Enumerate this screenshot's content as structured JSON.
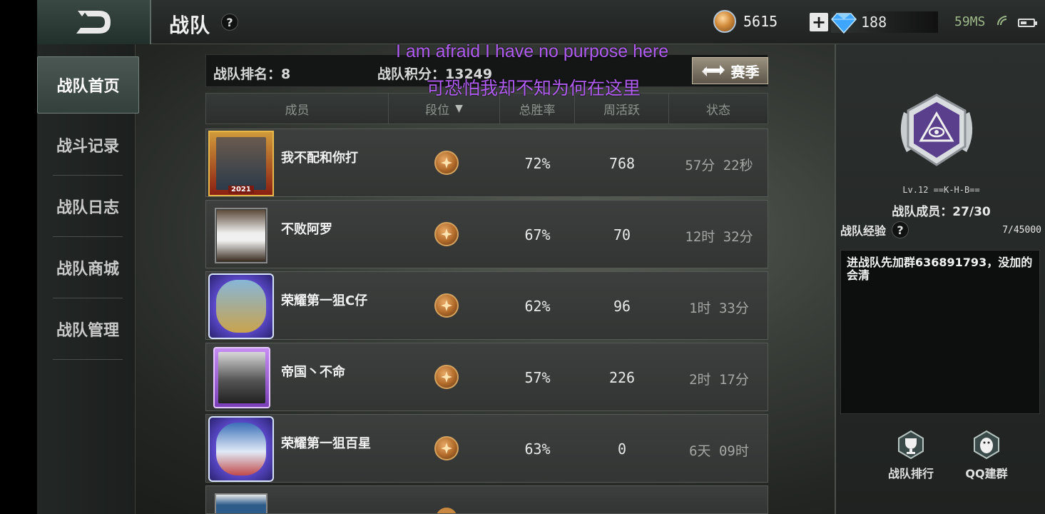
{
  "header": {
    "title": "战队",
    "help": "?",
    "coins": "5615",
    "gems": "188",
    "ping": "59MS"
  },
  "sidebar": {
    "items": [
      {
        "label": "战队首页"
      },
      {
        "label": "战斗记录"
      },
      {
        "label": "战队日志"
      },
      {
        "label": "战队商城"
      },
      {
        "label": "战队管理"
      }
    ]
  },
  "team": {
    "rank_label": "战队排名：8",
    "score_label": "战队积分：13249",
    "season_button": "赛季"
  },
  "table": {
    "headers": [
      "成员",
      "段位",
      "总胜率",
      "周活跃",
      "状态"
    ],
    "rows": [
      {
        "name": "我不配和你打",
        "win_rate": "72%",
        "weekly": "768",
        "status": "57分 22秒",
        "year": "2021"
      },
      {
        "name": "不败阿罗",
        "win_rate": "67%",
        "weekly": "70",
        "status": "12时 32分"
      },
      {
        "name": "荣耀第一狙C仔",
        "win_rate": "62%",
        "weekly": "96",
        "status": "1时 33分"
      },
      {
        "name": "帝国丶不命",
        "win_rate": "57%",
        "weekly": "226",
        "status": "2时 17分"
      },
      {
        "name": "荣耀第一狙百星",
        "win_rate": "63%",
        "weekly": "0",
        "status": "6天 09时"
      }
    ]
  },
  "right_panel": {
    "level": "Lv.12 ==K-H-B==",
    "members": "战队成员：27/30",
    "exp_label": "战队经验",
    "exp_help": "?",
    "exp_value": "7/45000",
    "notice": "进战队先加群636891793，没加的会清",
    "buttons": [
      {
        "label": "战队排行"
      },
      {
        "label": "QQ建群"
      }
    ]
  },
  "subtitles": {
    "english": "I am afraid I have no purpose here",
    "chinese": "可恐怕我却不知为何在这里"
  },
  "colors": {
    "subtitle": "#b05cf2",
    "active_tab": "#4b5753",
    "season_button": "#9a917f"
  }
}
